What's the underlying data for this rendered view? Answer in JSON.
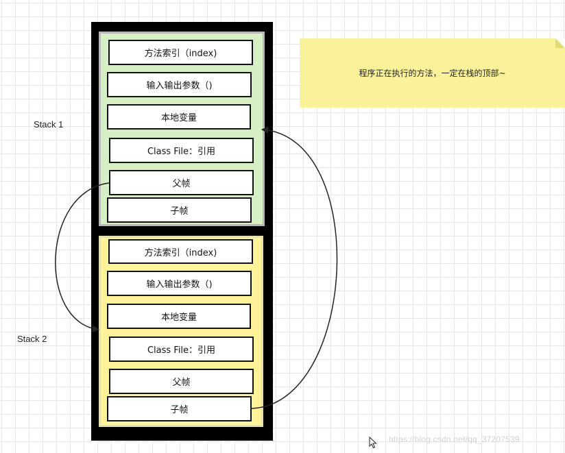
{
  "stacks": [
    {
      "label": "Stack 1",
      "color": "#d6efc4",
      "items": [
        "方法索引（index)",
        "输入输出参数（)",
        "本地变量",
        "Class File：引用",
        "父帧",
        "子帧"
      ]
    },
    {
      "label": "Stack 2",
      "color": "#fff39a",
      "items": [
        "方法索引（index)",
        "输入输出参数（)",
        "本地变量",
        "Class File：引用",
        "父帧",
        "子帧"
      ]
    }
  ],
  "note": {
    "text": "程序正在执行的方法，一定在栈的顶部~",
    "color": "#faf29a"
  },
  "watermark": "https://blog.csdn.net/qq_37207539",
  "icons": {
    "cursor": "mouse-pointer-icon"
  }
}
